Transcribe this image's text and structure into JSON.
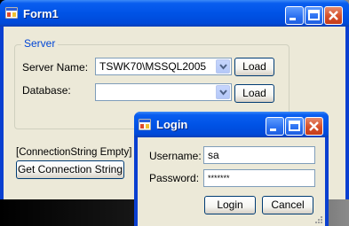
{
  "main_window": {
    "title": "Form1",
    "caption_buttons": {
      "minimize": "_",
      "maximize": "□",
      "close": "✕"
    },
    "server_group": {
      "label": "Server",
      "server_name_label": "Server Name:",
      "server_name_value": "TSWK70\\MSSQL2005",
      "server_load_label": "Load",
      "database_label": "Database:",
      "database_value": "",
      "database_load_label": "Load"
    },
    "connection_status": "[ConnectionString Empty]",
    "get_connection_button": "Get Connection String"
  },
  "login_dialog": {
    "title": "Login",
    "username_label": "Username:",
    "username_value": "sa",
    "password_label": "Password:",
    "password_value": "*******",
    "login_button": "Login",
    "cancel_button": "Cancel"
  },
  "colors": {
    "title_bar": "#0053e6",
    "client_bg": "#ece9d8",
    "group_label": "#0046d5",
    "close_button": "#d6502a"
  },
  "icons": {
    "app_icon": "form-app-icon",
    "dropdown": "chevron-down-icon",
    "resize": "resize-grip-icon"
  }
}
